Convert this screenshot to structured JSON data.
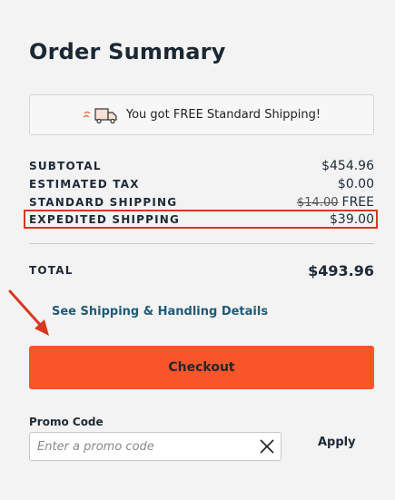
{
  "summary": {
    "title": "Order Summary",
    "shipping_banner": "You got FREE Standard Shipping!",
    "rows": {
      "subtotal": {
        "label": "SUBTOTAL",
        "value": "$454.96"
      },
      "tax": {
        "label": "ESTIMATED TAX",
        "value": "$0.00"
      },
      "standard": {
        "label": "STANDARD SHIPPING",
        "old_value": "$14.00",
        "value": "FREE"
      },
      "expedited": {
        "label": "EXPEDITED SHIPPING",
        "value": "$39.00"
      }
    },
    "total": {
      "label": "TOTAL",
      "value": "$493.96"
    },
    "details_link": "See Shipping & Handling Details",
    "checkout_label": "Checkout"
  },
  "promo": {
    "label": "Promo Code",
    "placeholder": "Enter a promo code",
    "apply_label": "Apply"
  },
  "icons": {
    "shipping": "truck-icon",
    "clear": "close-icon",
    "annotation": "arrow-icon"
  },
  "colors": {
    "accent": "#f9552a",
    "highlight": "#d8371f",
    "link": "#1f5b7a"
  }
}
